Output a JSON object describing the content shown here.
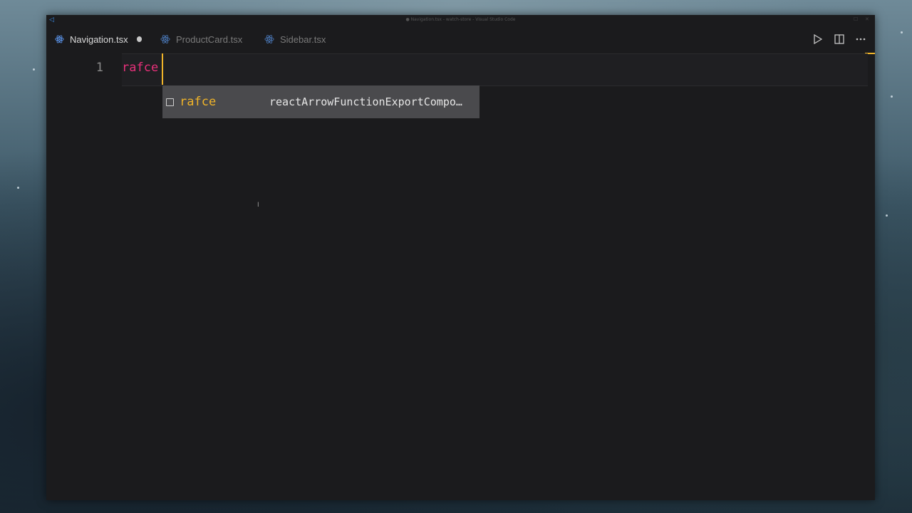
{
  "window": {
    "title": "● Navigation.tsx - watch-store - Visual Studio Code"
  },
  "tabs": [
    {
      "label": "Navigation.tsx",
      "active": true,
      "dirty": true,
      "icon": "react-icon"
    },
    {
      "label": "ProductCard.tsx",
      "active": false,
      "dirty": false,
      "icon": "react-icon"
    },
    {
      "label": "Sidebar.tsx",
      "active": false,
      "dirty": false,
      "icon": "react-icon"
    }
  ],
  "editor_actions": [
    "run-icon",
    "split-editor-icon",
    "more-actions-icon"
  ],
  "editor": {
    "line_number": "1",
    "line_text": "rafce"
  },
  "suggestion": {
    "label": "rafce",
    "detail": "reactArrowFunctionExportCompo…",
    "icon": "snippet-icon"
  },
  "colors": {
    "accent": "#f0b429",
    "code_text": "#e8307a",
    "react": "#61a0ff",
    "suggest_bg": "#4a4a4d"
  }
}
